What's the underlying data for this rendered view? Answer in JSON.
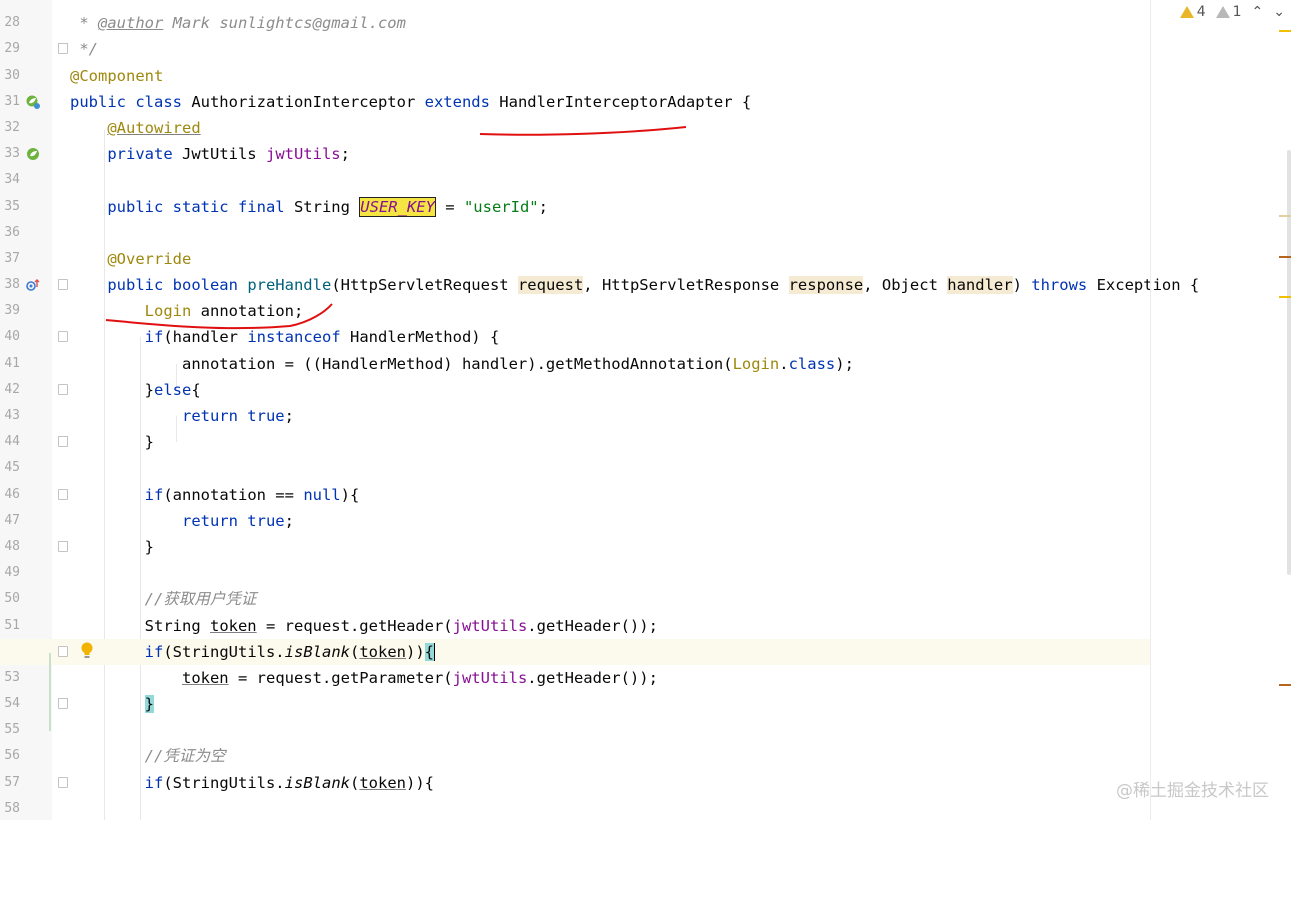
{
  "inspections": {
    "warnings": "4",
    "weak_warnings": "1"
  },
  "watermark": "@稀土掘金技术社区",
  "lines": [
    {
      "n": "28"
    },
    {
      "n": "29"
    },
    {
      "n": "30"
    },
    {
      "n": "31"
    },
    {
      "n": "32"
    },
    {
      "n": "33"
    },
    {
      "n": "34"
    },
    {
      "n": "35"
    },
    {
      "n": "36"
    },
    {
      "n": "37"
    },
    {
      "n": "38"
    },
    {
      "n": "39"
    },
    {
      "n": "40"
    },
    {
      "n": "41"
    },
    {
      "n": "42"
    },
    {
      "n": "43"
    },
    {
      "n": "44"
    },
    {
      "n": "45"
    },
    {
      "n": "46"
    },
    {
      "n": "47"
    },
    {
      "n": "48"
    },
    {
      "n": "49"
    },
    {
      "n": "50"
    },
    {
      "n": "51"
    },
    {
      "n": "52"
    },
    {
      "n": "53"
    },
    {
      "n": "54"
    },
    {
      "n": "55"
    },
    {
      "n": "56"
    },
    {
      "n": "57"
    },
    {
      "n": "58"
    }
  ],
  "code": {
    "l28": " *",
    "l29_star": " * ",
    "l29_tag": "@author",
    "l29_rest": " Mark sunlightcs@gmail.com",
    "l30": " */",
    "l31": "@Component",
    "l32_a": "public class",
    "l32_b": " AuthorizationInterceptor ",
    "l32_c": "extends",
    "l32_d": " HandlerInterceptorAdapter {",
    "l33": "@Autowired",
    "l34_a": "private",
    "l34_b": " JwtUtils ",
    "l34_c": "jwtUtils",
    "l34_d": ";",
    "l36_a": "public static final",
    "l36_b": " String ",
    "l36_c": "USER_KEY",
    "l36_d": " = ",
    "l36_e": "\"userId\"",
    "l36_f": ";",
    "l38": "@Override",
    "l39_a": "public boolean",
    "l39_b": " preHandle",
    "l39_c": "(HttpServletRequest ",
    "l39_d": "request",
    "l39_e": ", HttpServletResponse ",
    "l39_f": "response",
    "l39_g": ", Object ",
    "l39_h": "handler",
    "l39_i": ") ",
    "l39_j": "throws",
    "l39_k": " Exception {",
    "l40_a": "Login",
    "l40_b": " annotation;",
    "l41_a": "if",
    "l41_b": "(handler ",
    "l41_c": "instanceof",
    "l41_d": " HandlerMethod) {",
    "l42_a": "annotation = ((HandlerMethod) handler).getMethodAnnotation(",
    "l42_b": "Login",
    "l42_c": ".",
    "l42_d": "class",
    "l42_e": ");",
    "l43_a": "}",
    "l43_b": "else",
    "l43_c": "{",
    "l44_a": "return true",
    "l44_b": ";",
    "l45": "}",
    "l47_a": "if",
    "l47_b": "(annotation == ",
    "l47_c": "null",
    "l47_d": "){",
    "l48_a": "return true",
    "l48_b": ";",
    "l49": "}",
    "l51": "//获取用户凭证",
    "l52_a": "String ",
    "l52_b": "token",
    "l52_c": " = request.getHeader(",
    "l52_d": "jwtUtils",
    "l52_e": ".getHeader());",
    "l53_a": "if",
    "l53_b": "(StringUtils.",
    "l53_c": "isBlank",
    "l53_d": "(",
    "l53_e": "token",
    "l53_f": "))",
    "l53_g": "{",
    "l54_a": "token",
    "l54_b": " = request.getParameter(",
    "l54_c": "jwtUtils",
    "l54_d": ".getHeader());",
    "l55": "}",
    "l57": "//凭证为空",
    "l58_a": "if",
    "l58_b": "(StringUtils.",
    "l58_c": "isBlank",
    "l58_d": "(",
    "l58_e": "token",
    "l58_f": ")){"
  }
}
